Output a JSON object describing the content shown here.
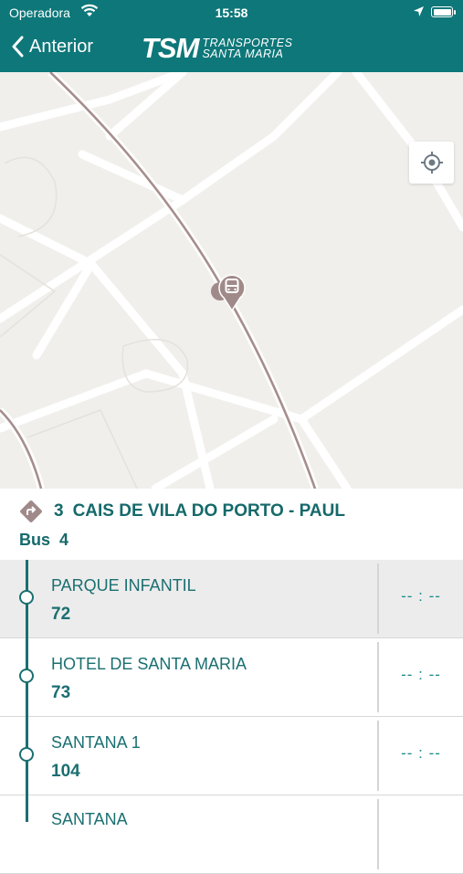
{
  "status_bar": {
    "carrier": "Operadora",
    "time": "15:58"
  },
  "nav": {
    "back_label": "Anterior",
    "logo_mark": "TSM",
    "logo_line1": "TRANSPORTES",
    "logo_line2": "SANTA MARIA"
  },
  "route": {
    "number": "3",
    "name": "CAIS DE VILA DO PORTO - PAUL",
    "bus_label": "Bus",
    "bus_number": "4"
  },
  "stops": [
    {
      "name": "PARQUE INFANTIL",
      "code": "72",
      "eta": "-- : --"
    },
    {
      "name": "HOTEL DE SANTA MARIA",
      "code": "73",
      "eta": "-- : --"
    },
    {
      "name": "SANTANA 1",
      "code": "104",
      "eta": "-- : --"
    },
    {
      "name": "SANTANA",
      "code": "",
      "eta": ""
    }
  ],
  "colors": {
    "header": "#0e7779",
    "accent": "#1b6f71",
    "map_bg": "#f0efec",
    "marker": "#a08a89"
  }
}
